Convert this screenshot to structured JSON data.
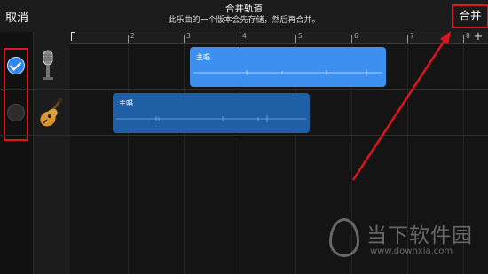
{
  "header": {
    "cancel_label": "取消",
    "title": "合并轨道",
    "subtitle": "此乐曲的一个版本会先存储，然后再合并。",
    "merge_label": "合并"
  },
  "ruler": {
    "bar_labels": [
      "2",
      "3",
      "4",
      "5",
      "6",
      "7",
      "8"
    ],
    "add_label": "+"
  },
  "tracks": [
    {
      "name": "主唱",
      "instrument_icon": "microphone-icon",
      "selected": true
    },
    {
      "name": "主唱",
      "instrument_icon": "acoustic-guitar-icon",
      "selected": false
    }
  ],
  "watermark": {
    "text": "当下软件园",
    "url": "www.downxia.com"
  },
  "colors": {
    "annotation": "#e0141c",
    "checkbox_on": "#2f86f6",
    "region_selected": "#3d8ff0",
    "region_unselected": "#1e5fa6"
  }
}
